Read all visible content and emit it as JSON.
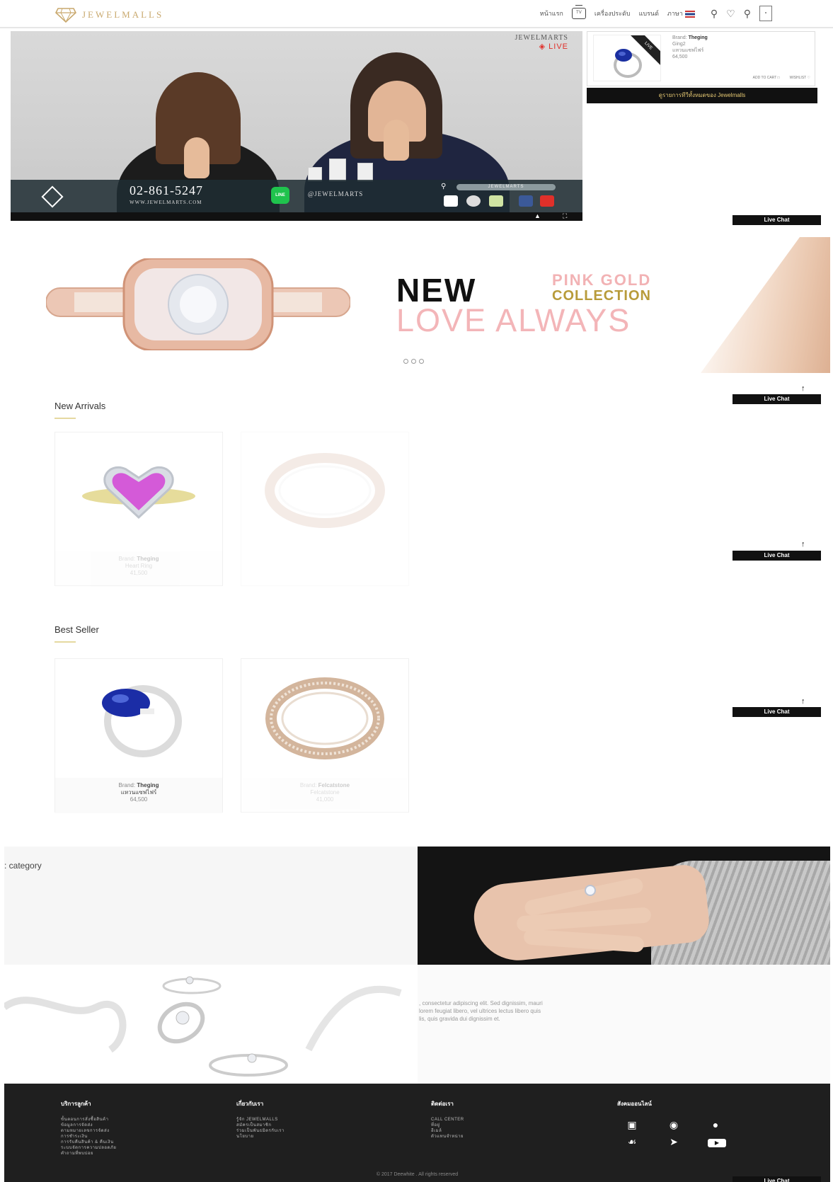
{
  "header": {
    "logo_text": "JEWELMALLS",
    "nav": {
      "home": "หน้าแรก",
      "tv_badge": "TV",
      "jewelry": "เครื่องประดับ",
      "brand": "แบรนด์",
      "language": "ภาษา"
    }
  },
  "video": {
    "brand": "JEWELMARTS",
    "live": "LIVE",
    "phone": "02-861-5247",
    "url": "WWW.JEWELMARTS.COM",
    "line_label": "LINE",
    "line_handle": "@JEWELMARTS",
    "search_pill": "JEWELMARTS"
  },
  "product_card": {
    "ribbon": "LIVE",
    "brand_label": "Brand:",
    "brand": "Theging",
    "name": "Ging2",
    "desc": "แหวนแซฟไฟร์",
    "price": "64,500",
    "link_cart": "ADD TO CART",
    "link_wish": "WISHLIST"
  },
  "promo_button": "ดูรายการทีวีทั้งหมดของ Jewelmalls",
  "live_chat": "Live Chat",
  "hero": {
    "new": "NEW",
    "pink_gold": "PINK GOLD",
    "collection": "COLLECTION",
    "love_always": "LOVE ALWAYS"
  },
  "new_arrivals": {
    "title": "New Arrivals",
    "items": [
      {
        "brand_label": "Brand:",
        "brand": "Theging",
        "name": "Heart Ring",
        "price": "41,500"
      },
      {
        "brand_label": "",
        "brand": "",
        "name": "",
        "price": ""
      }
    ]
  },
  "best_seller": {
    "title": "Best Seller",
    "items": [
      {
        "brand_label": "Brand:",
        "brand": "Theging",
        "name": "แหวนแซฟไฟร์",
        "price": "64,500"
      },
      {
        "brand_label": "Brand:",
        "brand": "Felcatstone",
        "name": "Felcatstone",
        "price": "41,000"
      }
    ]
  },
  "category": {
    "label": ": category",
    "text_line1": ", consectetur adipiscing elit. Sed dignissim, mauri",
    "text_line2": "lorem feugiat libero, vel ultrices lectus libero quis",
    "text_line3": "lis, quis gravida dui dignissim et."
  },
  "footer": {
    "col1": {
      "title": "บริการลูกค้า",
      "items": [
        "ขั้นตอนการสั่งซื้อสินค้า",
        "ข้อมูลการจัดส่ง",
        "ตามหมายเลขการจัดส่ง",
        "การชำระเงิน",
        "การรับคืนสินค้า & คืนเงิน",
        "ระบบจัดการความปลอดภัย",
        "คำถามที่พบบ่อย"
      ]
    },
    "col2": {
      "title": "เกี่ยวกับเรา",
      "items": [
        "รู้จัก JEWELMALLS",
        "สมัครเป็นสมาชิก",
        "ร่วมเป็นพันธมิตรกับเรา",
        "นโยบาย"
      ]
    },
    "col3": {
      "title": "ติดต่อเรา",
      "items": [
        "CALL CENTER",
        "ที่อยู่",
        "อีเมล์",
        "ตัวแทนจำหน่าย"
      ]
    },
    "col4": {
      "title": "สังคมออนไลน์"
    },
    "copyright": "© 2017 Deewhite . All rights reserved"
  },
  "colors": {
    "gold": "#c9a96e",
    "live_red": "#e0302a",
    "footer_bg": "#1f1f1f"
  }
}
